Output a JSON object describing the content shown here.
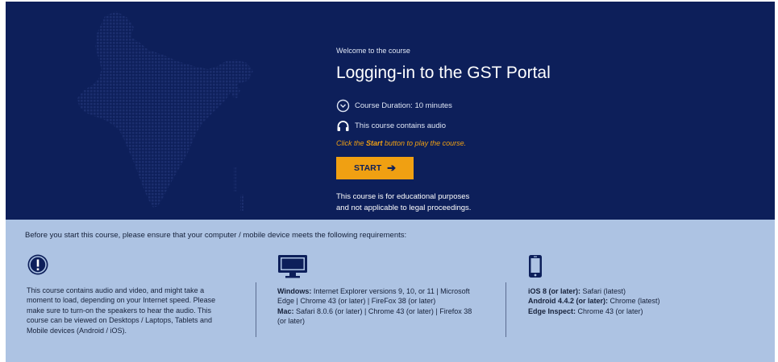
{
  "hero": {
    "welcome": "Welcome to the course",
    "title": "Logging-in to the GST Portal",
    "duration_label": "Course Duration:",
    "duration_value": "10 minutes",
    "audio_text": "This course contains audio",
    "click_prefix": "Click the ",
    "click_bold": "Start",
    "click_suffix": " button to play the course.",
    "start_label": "START",
    "disclaimer_line1": "This course is for educational purposes",
    "disclaimer_line2": "and not applicable to legal proceedings.",
    "colors": {
      "background": "#0d1f5a",
      "accent": "#f0a012",
      "map_dots": "#1b2e6e"
    },
    "icons": [
      "india-map-dots",
      "clock-icon",
      "headphones-icon",
      "arrow-right-icon"
    ]
  },
  "requirements": {
    "intro": "Before you start this course, please ensure that your computer / mobile device meets the following requirements:",
    "audio_note_lines": [
      "This course contains audio and video, and might take a",
      "moment to load, depending on your Internet speed. Please",
      "make sure to turn-on the speakers to hear the audio. This",
      "course can be viewed on Desktops / Laptops, Tablets and",
      "Mobile devices (Android / iOS)."
    ],
    "windows_label": "Windows:",
    "windows_line1": " Internet Explorer versions 9, 10, or 11 | Microsoft",
    "windows_line2": "Edge | Chrome 43 (or later) | FireFox 38 (or later)",
    "mac_label": "Mac:",
    "mac_line1": " Safari 8.0.6 (or later) | Chrome 43 (or later) | Firefox 38",
    "mac_line2": "(or later)",
    "ios_label": "iOS 8 (or later):",
    "ios_value": " Safari (latest)",
    "android_label": "Android 4.4.2 (or later):",
    "android_value": " Chrome (latest)",
    "edge_label": "Edge Inspect:",
    "edge_value": " Chrome 43 (or later)",
    "colors": {
      "background": "#adc3e3",
      "icon": "#0d1f5a"
    },
    "icons": [
      "info-icon",
      "monitor-icon",
      "mobile-icon"
    ]
  }
}
